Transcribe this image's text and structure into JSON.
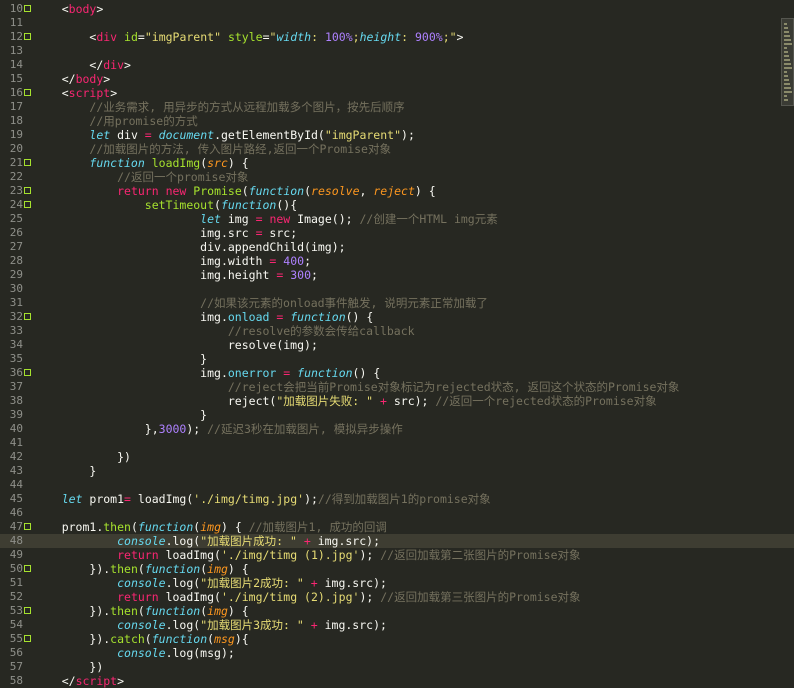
{
  "editor": {
    "language": "html",
    "current_line": 48,
    "lines": [
      {
        "n": "10",
        "fold": true,
        "tokens": [
          [
            "    ",
            "t"
          ],
          [
            "<",
            "p"
          ],
          [
            "body",
            "tag"
          ],
          [
            ">",
            "p"
          ]
        ]
      },
      {
        "n": "11",
        "fold": false,
        "tokens": []
      },
      {
        "n": "12",
        "fold": true,
        "tokens": [
          [
            "        ",
            "t"
          ],
          [
            "<",
            "p"
          ],
          [
            "div",
            "tag"
          ],
          [
            " ",
            "t"
          ],
          [
            "id",
            "attr"
          ],
          [
            "=",
            "p"
          ],
          [
            "\"imgParent\"",
            "str"
          ],
          [
            " ",
            "t"
          ],
          [
            "style",
            "attr"
          ],
          [
            "=",
            "p"
          ],
          [
            "\"",
            "str"
          ],
          [
            "width",
            "const"
          ],
          [
            ": ",
            "str"
          ],
          [
            "100%",
            "num"
          ],
          [
            ";",
            "str"
          ],
          [
            "height",
            "const"
          ],
          [
            ": ",
            "str"
          ],
          [
            "900%",
            "num"
          ],
          [
            ";\"",
            "str"
          ],
          [
            ">",
            "p"
          ]
        ]
      },
      {
        "n": "13",
        "fold": false,
        "tokens": []
      },
      {
        "n": "14",
        "fold": false,
        "tokens": [
          [
            "        ",
            "t"
          ],
          [
            "</",
            "p"
          ],
          [
            "div",
            "tag"
          ],
          [
            ">",
            "p"
          ]
        ]
      },
      {
        "n": "15",
        "fold": false,
        "tokens": [
          [
            "    ",
            "t"
          ],
          [
            "</",
            "p"
          ],
          [
            "body",
            "tag"
          ],
          [
            ">",
            "p"
          ]
        ]
      },
      {
        "n": "16",
        "fold": true,
        "tokens": [
          [
            "    ",
            "t"
          ],
          [
            "<",
            "p"
          ],
          [
            "script",
            "tag"
          ],
          [
            ">",
            "p"
          ]
        ]
      },
      {
        "n": "17",
        "fold": false,
        "tokens": [
          [
            "        ",
            "t"
          ],
          [
            "//业务需求, 用异步的方式从远程加载多个图片，按先后顺序",
            "com"
          ]
        ]
      },
      {
        "n": "18",
        "fold": false,
        "tokens": [
          [
            "        ",
            "t"
          ],
          [
            "//用promise的方式",
            "com"
          ]
        ]
      },
      {
        "n": "19",
        "fold": false,
        "tokens": [
          [
            "        ",
            "t"
          ],
          [
            "let",
            "kw"
          ],
          [
            " div ",
            "t"
          ],
          [
            "=",
            "op"
          ],
          [
            " ",
            "t"
          ],
          [
            "document",
            "const"
          ],
          [
            ".getElementById(",
            "t"
          ],
          [
            "\"imgParent\"",
            "str"
          ],
          [
            ");",
            "t"
          ]
        ]
      },
      {
        "n": "20",
        "fold": false,
        "tokens": [
          [
            "        ",
            "t"
          ],
          [
            "//加载图片的方法, 传入图片路经,返回一个Promise对象",
            "com"
          ]
        ]
      },
      {
        "n": "21",
        "fold": true,
        "tokens": [
          [
            "        ",
            "t"
          ],
          [
            "function",
            "kw"
          ],
          [
            " ",
            "t"
          ],
          [
            "loadImg",
            "fn"
          ],
          [
            "(",
            "t"
          ],
          [
            "src",
            "param"
          ],
          [
            ") {",
            "t"
          ]
        ]
      },
      {
        "n": "22",
        "fold": false,
        "tokens": [
          [
            "            ",
            "t"
          ],
          [
            "//返回一个promise对象",
            "com"
          ]
        ]
      },
      {
        "n": "23",
        "fold": true,
        "tokens": [
          [
            "            ",
            "t"
          ],
          [
            "return",
            "op"
          ],
          [
            " ",
            "t"
          ],
          [
            "new",
            "op"
          ],
          [
            " ",
            "t"
          ],
          [
            "Promise",
            "fn"
          ],
          [
            "(",
            "t"
          ],
          [
            "function",
            "kw"
          ],
          [
            "(",
            "t"
          ],
          [
            "resolve",
            "param"
          ],
          [
            ", ",
            "t"
          ],
          [
            "reject",
            "param"
          ],
          [
            ") {",
            "t"
          ]
        ]
      },
      {
        "n": "24",
        "fold": true,
        "tokens": [
          [
            "                ",
            "t"
          ],
          [
            "setTimeout",
            "fn"
          ],
          [
            "(",
            "t"
          ],
          [
            "function",
            "kw"
          ],
          [
            "(){",
            "t"
          ]
        ]
      },
      {
        "n": "25",
        "fold": false,
        "tokens": [
          [
            "                        ",
            "t"
          ],
          [
            "let",
            "kw"
          ],
          [
            " img ",
            "t"
          ],
          [
            "=",
            "op"
          ],
          [
            " ",
            "t"
          ],
          [
            "new",
            "op"
          ],
          [
            " Image(); ",
            "t"
          ],
          [
            "//创建一个HTML img元素",
            "com"
          ]
        ]
      },
      {
        "n": "26",
        "fold": false,
        "tokens": [
          [
            "                        ",
            "t"
          ],
          [
            "img.src ",
            "t"
          ],
          [
            "=",
            "op"
          ],
          [
            " src;",
            "t"
          ]
        ]
      },
      {
        "n": "27",
        "fold": false,
        "tokens": [
          [
            "                        ",
            "t"
          ],
          [
            "div.appendChild(img);",
            "t"
          ]
        ]
      },
      {
        "n": "28",
        "fold": false,
        "tokens": [
          [
            "                        ",
            "t"
          ],
          [
            "img.width ",
            "t"
          ],
          [
            "=",
            "op"
          ],
          [
            " ",
            "t"
          ],
          [
            "400",
            "num"
          ],
          [
            ";",
            "t"
          ]
        ]
      },
      {
        "n": "29",
        "fold": false,
        "tokens": [
          [
            "                        ",
            "t"
          ],
          [
            "img.height ",
            "t"
          ],
          [
            "=",
            "op"
          ],
          [
            " ",
            "t"
          ],
          [
            "300",
            "num"
          ],
          [
            ";",
            "t"
          ]
        ]
      },
      {
        "n": "30",
        "fold": false,
        "tokens": []
      },
      {
        "n": "31",
        "fold": false,
        "tokens": [
          [
            "                        ",
            "t"
          ],
          [
            "//如果该元素的onload事件触发, 说明元素正常加载了",
            "com"
          ]
        ]
      },
      {
        "n": "32",
        "fold": true,
        "tokens": [
          [
            "                        ",
            "t"
          ],
          [
            "img.",
            "t"
          ],
          [
            "onload",
            "prop"
          ],
          [
            " ",
            "t"
          ],
          [
            "=",
            "op"
          ],
          [
            " ",
            "t"
          ],
          [
            "function",
            "kw"
          ],
          [
            "() {",
            "t"
          ]
        ]
      },
      {
        "n": "33",
        "fold": false,
        "tokens": [
          [
            "                            ",
            "t"
          ],
          [
            "//resolve的参数会传给callback",
            "com"
          ]
        ]
      },
      {
        "n": "34",
        "fold": false,
        "tokens": [
          [
            "                            ",
            "t"
          ],
          [
            "resolve(img);",
            "t"
          ]
        ]
      },
      {
        "n": "35",
        "fold": false,
        "tokens": [
          [
            "                        ",
            "t"
          ],
          [
            "}",
            "t"
          ]
        ]
      },
      {
        "n": "36",
        "fold": true,
        "tokens": [
          [
            "                        ",
            "t"
          ],
          [
            "img.",
            "t"
          ],
          [
            "onerror",
            "prop"
          ],
          [
            " ",
            "t"
          ],
          [
            "=",
            "op"
          ],
          [
            " ",
            "t"
          ],
          [
            "function",
            "kw"
          ],
          [
            "() {",
            "t"
          ]
        ]
      },
      {
        "n": "37",
        "fold": false,
        "tokens": [
          [
            "                            ",
            "t"
          ],
          [
            "//reject会把当前Promise对象标记为rejected状态, 返回这个状态的Promise对象",
            "com"
          ]
        ]
      },
      {
        "n": "38",
        "fold": false,
        "tokens": [
          [
            "                            ",
            "t"
          ],
          [
            "reject(",
            "t"
          ],
          [
            "\"加载图片失败: \"",
            "str"
          ],
          [
            " ",
            "t"
          ],
          [
            "+",
            "op"
          ],
          [
            " src); ",
            "t"
          ],
          [
            "//返回一个rejected状态的Promise对象",
            "com"
          ]
        ]
      },
      {
        "n": "39",
        "fold": false,
        "tokens": [
          [
            "                        ",
            "t"
          ],
          [
            "}",
            "t"
          ]
        ]
      },
      {
        "n": "40",
        "fold": false,
        "tokens": [
          [
            "                ",
            "t"
          ],
          [
            "},",
            "t"
          ],
          [
            "3000",
            "num"
          ],
          [
            "); ",
            "t"
          ],
          [
            "//延迟3秒在加载图片, 模拟异步操作",
            "com"
          ]
        ]
      },
      {
        "n": "41",
        "fold": false,
        "tokens": []
      },
      {
        "n": "42",
        "fold": false,
        "tokens": [
          [
            "            ",
            "t"
          ],
          [
            "})",
            "t"
          ]
        ]
      },
      {
        "n": "43",
        "fold": false,
        "tokens": [
          [
            "        ",
            "t"
          ],
          [
            "}",
            "t"
          ]
        ]
      },
      {
        "n": "44",
        "fold": false,
        "tokens": []
      },
      {
        "n": "45",
        "fold": false,
        "tokens": [
          [
            "    ",
            "t"
          ],
          [
            "let",
            "kw"
          ],
          [
            " prom1",
            "t"
          ],
          [
            "=",
            "op"
          ],
          [
            " loadImg(",
            "t"
          ],
          [
            "'./img/timg.jpg'",
            "str"
          ],
          [
            ");",
            "t"
          ],
          [
            "//得到加载图片1的promise对象",
            "com"
          ]
        ]
      },
      {
        "n": "46",
        "fold": false,
        "tokens": []
      },
      {
        "n": "47",
        "fold": true,
        "tokens": [
          [
            "    ",
            "t"
          ],
          [
            "prom1.",
            "t"
          ],
          [
            "then",
            "fn"
          ],
          [
            "(",
            "t"
          ],
          [
            "function",
            "kw"
          ],
          [
            "(",
            "t"
          ],
          [
            "img",
            "param"
          ],
          [
            ") { ",
            "t"
          ],
          [
            "//加载图片1, 成功的回调",
            "com"
          ]
        ]
      },
      {
        "n": "48",
        "fold": false,
        "tokens": [
          [
            "            ",
            "t"
          ],
          [
            "console",
            "const"
          ],
          [
            ".log(",
            "t"
          ],
          [
            "\"加载图片成功: \"",
            "str"
          ],
          [
            " ",
            "t"
          ],
          [
            "+",
            "op"
          ],
          [
            " img.src);",
            "t"
          ]
        ]
      },
      {
        "n": "49",
        "fold": false,
        "tokens": [
          [
            "            ",
            "t"
          ],
          [
            "return",
            "op"
          ],
          [
            " loadImg(",
            "t"
          ],
          [
            "'./img/timg (1).jpg'",
            "str"
          ],
          [
            "); ",
            "t"
          ],
          [
            "//返回加载第二张图片的Promise对象",
            "com"
          ]
        ]
      },
      {
        "n": "50",
        "fold": true,
        "tokens": [
          [
            "        ",
            "t"
          ],
          [
            "}).",
            "t"
          ],
          [
            "then",
            "fn"
          ],
          [
            "(",
            "t"
          ],
          [
            "function",
            "kw"
          ],
          [
            "(",
            "t"
          ],
          [
            "img",
            "param"
          ],
          [
            ") {",
            "t"
          ]
        ]
      },
      {
        "n": "51",
        "fold": false,
        "tokens": [
          [
            "            ",
            "t"
          ],
          [
            "console",
            "const"
          ],
          [
            ".log(",
            "t"
          ],
          [
            "\"加载图片2成功: \"",
            "str"
          ],
          [
            " ",
            "t"
          ],
          [
            "+",
            "op"
          ],
          [
            " img.src);",
            "t"
          ]
        ]
      },
      {
        "n": "52",
        "fold": false,
        "tokens": [
          [
            "            ",
            "t"
          ],
          [
            "return",
            "op"
          ],
          [
            " loadImg(",
            "t"
          ],
          [
            "'./img/timg (2).jpg'",
            "str"
          ],
          [
            "); ",
            "t"
          ],
          [
            "//返回加载第三张图片的Promise对象",
            "com"
          ]
        ]
      },
      {
        "n": "53",
        "fold": true,
        "tokens": [
          [
            "        ",
            "t"
          ],
          [
            "}).",
            "t"
          ],
          [
            "then",
            "fn"
          ],
          [
            "(",
            "t"
          ],
          [
            "function",
            "kw"
          ],
          [
            "(",
            "t"
          ],
          [
            "img",
            "param"
          ],
          [
            ") {",
            "t"
          ]
        ]
      },
      {
        "n": "54",
        "fold": false,
        "tokens": [
          [
            "            ",
            "t"
          ],
          [
            "console",
            "const"
          ],
          [
            ".log(",
            "t"
          ],
          [
            "\"加载图片3成功: \"",
            "str"
          ],
          [
            " ",
            "t"
          ],
          [
            "+",
            "op"
          ],
          [
            " img.src);",
            "t"
          ]
        ]
      },
      {
        "n": "55",
        "fold": true,
        "tokens": [
          [
            "        ",
            "t"
          ],
          [
            "}).",
            "t"
          ],
          [
            "catch",
            "fn"
          ],
          [
            "(",
            "t"
          ],
          [
            "function",
            "kw"
          ],
          [
            "(",
            "t"
          ],
          [
            "msg",
            "param"
          ],
          [
            "){",
            "t"
          ]
        ]
      },
      {
        "n": "56",
        "fold": false,
        "tokens": [
          [
            "            ",
            "t"
          ],
          [
            "console",
            "const"
          ],
          [
            ".log(msg);",
            "t"
          ]
        ]
      },
      {
        "n": "57",
        "fold": false,
        "tokens": [
          [
            "        ",
            "t"
          ],
          [
            "})",
            "t"
          ]
        ]
      },
      {
        "n": "58",
        "fold": false,
        "tokens": [
          [
            "    ",
            "t"
          ],
          [
            "</",
            "p"
          ],
          [
            "script",
            "tag"
          ],
          [
            ">",
            "p"
          ]
        ]
      }
    ]
  },
  "colors": {
    "background": "#272822",
    "current_line": "#3e3d32",
    "foreground": "#f8f8f2",
    "tag": "#f92672",
    "attribute": "#a6e22e",
    "string": "#e6db74",
    "keyword": "#66d9ef",
    "number": "#ae81ff",
    "function": "#a6e22e",
    "parameter": "#fd971f",
    "comment": "#75715e",
    "line_number": "#8f908a"
  },
  "minimap": {
    "icon": "minimap-icon"
  }
}
